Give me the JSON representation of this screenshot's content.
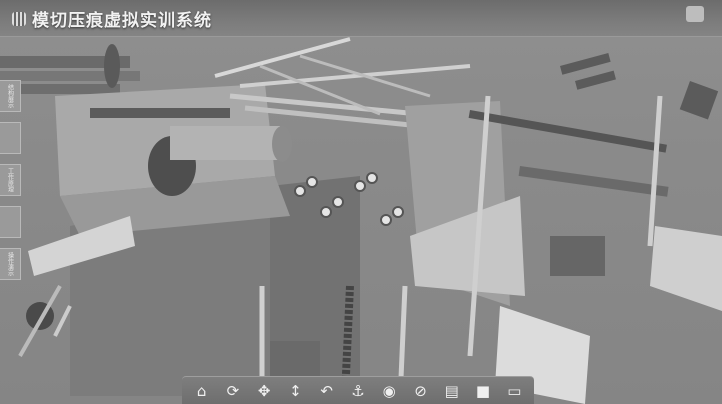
{
  "app": {
    "title": "模切压痕虚拟实训系统",
    "logo_text": ""
  },
  "sidebar": {
    "items": [
      {
        "label": "结构展示"
      },
      {
        "label": ""
      },
      {
        "label": "工作原理"
      },
      {
        "label": ""
      },
      {
        "label": "操作演示"
      }
    ]
  },
  "toolbar": {
    "tools": [
      {
        "icon": "home-icon",
        "glyph": "⌂"
      },
      {
        "icon": "rotate-icon",
        "glyph": "⟳"
      },
      {
        "icon": "pan-icon",
        "glyph": "✥"
      },
      {
        "icon": "zoom-icon",
        "glyph": "↕"
      },
      {
        "icon": "rotate-left-icon",
        "glyph": "↶"
      },
      {
        "icon": "crane-icon",
        "glyph": "⚓"
      },
      {
        "icon": "show-icon",
        "glyph": "◉"
      },
      {
        "icon": "hide-icon",
        "glyph": "⊘"
      },
      {
        "icon": "panel-icon",
        "glyph": "▤"
      },
      {
        "icon": "fullscreen-icon",
        "glyph": "■"
      },
      {
        "icon": "camera-icon",
        "glyph": "▭"
      }
    ]
  }
}
